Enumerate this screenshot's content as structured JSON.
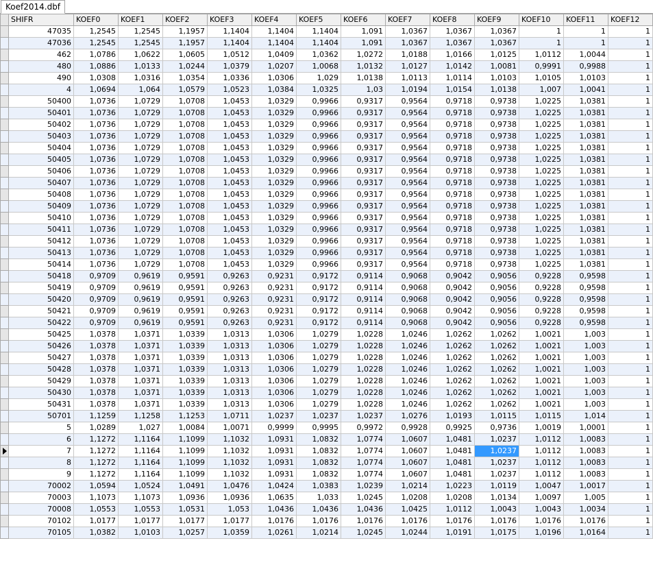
{
  "window": {
    "tab_label": "Koef2014.dbf"
  },
  "columns": [
    "SHIFR",
    "KOEF0",
    "KOEF1",
    "KOEF2",
    "KOEF3",
    "KOEF4",
    "KOEF5",
    "KOEF6",
    "KOEF7",
    "KOEF8",
    "KOEF9",
    "KOEF10",
    "KOEF11",
    "KOEF12"
  ],
  "rows": [
    [
      "47035",
      "1,2545",
      "1,2545",
      "1,1957",
      "1,1404",
      "1,1404",
      "1,1404",
      "1,091",
      "1,0367",
      "1,0367",
      "1,0367",
      "1",
      "1",
      "1"
    ],
    [
      "47036",
      "1,2545",
      "1,2545",
      "1,1957",
      "1,1404",
      "1,1404",
      "1,1404",
      "1,091",
      "1,0367",
      "1,0367",
      "1,0367",
      "1",
      "1",
      "1"
    ],
    [
      "462",
      "1,0786",
      "1,0622",
      "1,0605",
      "1,0512",
      "1,0409",
      "1,0362",
      "1,0272",
      "1,0188",
      "1,0166",
      "1,0125",
      "1,0112",
      "1,0044",
      "1"
    ],
    [
      "480",
      "1,0886",
      "1,0133",
      "1,0244",
      "1,0379",
      "1,0207",
      "1,0068",
      "1,0132",
      "1,0127",
      "1,0142",
      "1,0081",
      "0,9991",
      "0,9988",
      "1"
    ],
    [
      "490",
      "1,0308",
      "1,0316",
      "1,0354",
      "1,0336",
      "1,0306",
      "1,029",
      "1,0138",
      "1,0113",
      "1,0114",
      "1,0103",
      "1,0105",
      "1,0103",
      "1"
    ],
    [
      "4",
      "1,0694",
      "1,064",
      "1,0579",
      "1,0523",
      "1,0384",
      "1,0325",
      "1,03",
      "1,0194",
      "1,0154",
      "1,0138",
      "1,007",
      "1,0041",
      "1"
    ],
    [
      "50400",
      "1,0736",
      "1,0729",
      "1,0708",
      "1,0453",
      "1,0329",
      "0,9966",
      "0,9317",
      "0,9564",
      "0,9718",
      "0,9738",
      "1,0225",
      "1,0381",
      "1"
    ],
    [
      "50401",
      "1,0736",
      "1,0729",
      "1,0708",
      "1,0453",
      "1,0329",
      "0,9966",
      "0,9317",
      "0,9564",
      "0,9718",
      "0,9738",
      "1,0225",
      "1,0381",
      "1"
    ],
    [
      "50402",
      "1,0736",
      "1,0729",
      "1,0708",
      "1,0453",
      "1,0329",
      "0,9966",
      "0,9317",
      "0,9564",
      "0,9718",
      "0,9738",
      "1,0225",
      "1,0381",
      "1"
    ],
    [
      "50403",
      "1,0736",
      "1,0729",
      "1,0708",
      "1,0453",
      "1,0329",
      "0,9966",
      "0,9317",
      "0,9564",
      "0,9718",
      "0,9738",
      "1,0225",
      "1,0381",
      "1"
    ],
    [
      "50404",
      "1,0736",
      "1,0729",
      "1,0708",
      "1,0453",
      "1,0329",
      "0,9966",
      "0,9317",
      "0,9564",
      "0,9718",
      "0,9738",
      "1,0225",
      "1,0381",
      "1"
    ],
    [
      "50405",
      "1,0736",
      "1,0729",
      "1,0708",
      "1,0453",
      "1,0329",
      "0,9966",
      "0,9317",
      "0,9564",
      "0,9718",
      "0,9738",
      "1,0225",
      "1,0381",
      "1"
    ],
    [
      "50406",
      "1,0736",
      "1,0729",
      "1,0708",
      "1,0453",
      "1,0329",
      "0,9966",
      "0,9317",
      "0,9564",
      "0,9718",
      "0,9738",
      "1,0225",
      "1,0381",
      "1"
    ],
    [
      "50407",
      "1,0736",
      "1,0729",
      "1,0708",
      "1,0453",
      "1,0329",
      "0,9966",
      "0,9317",
      "0,9564",
      "0,9718",
      "0,9738",
      "1,0225",
      "1,0381",
      "1"
    ],
    [
      "50408",
      "1,0736",
      "1,0729",
      "1,0708",
      "1,0453",
      "1,0329",
      "0,9966",
      "0,9317",
      "0,9564",
      "0,9718",
      "0,9738",
      "1,0225",
      "1,0381",
      "1"
    ],
    [
      "50409",
      "1,0736",
      "1,0729",
      "1,0708",
      "1,0453",
      "1,0329",
      "0,9966",
      "0,9317",
      "0,9564",
      "0,9718",
      "0,9738",
      "1,0225",
      "1,0381",
      "1"
    ],
    [
      "50410",
      "1,0736",
      "1,0729",
      "1,0708",
      "1,0453",
      "1,0329",
      "0,9966",
      "0,9317",
      "0,9564",
      "0,9718",
      "0,9738",
      "1,0225",
      "1,0381",
      "1"
    ],
    [
      "50411",
      "1,0736",
      "1,0729",
      "1,0708",
      "1,0453",
      "1,0329",
      "0,9966",
      "0,9317",
      "0,9564",
      "0,9718",
      "0,9738",
      "1,0225",
      "1,0381",
      "1"
    ],
    [
      "50412",
      "1,0736",
      "1,0729",
      "1,0708",
      "1,0453",
      "1,0329",
      "0,9966",
      "0,9317",
      "0,9564",
      "0,9718",
      "0,9738",
      "1,0225",
      "1,0381",
      "1"
    ],
    [
      "50413",
      "1,0736",
      "1,0729",
      "1,0708",
      "1,0453",
      "1,0329",
      "0,9966",
      "0,9317",
      "0,9564",
      "0,9718",
      "0,9738",
      "1,0225",
      "1,0381",
      "1"
    ],
    [
      "50414",
      "1,0736",
      "1,0729",
      "1,0708",
      "1,0453",
      "1,0329",
      "0,9966",
      "0,9317",
      "0,9564",
      "0,9718",
      "0,9738",
      "1,0225",
      "1,0381",
      "1"
    ],
    [
      "50418",
      "0,9709",
      "0,9619",
      "0,9591",
      "0,9263",
      "0,9231",
      "0,9172",
      "0,9114",
      "0,9068",
      "0,9042",
      "0,9056",
      "0,9228",
      "0,9598",
      "1"
    ],
    [
      "50419",
      "0,9709",
      "0,9619",
      "0,9591",
      "0,9263",
      "0,9231",
      "0,9172",
      "0,9114",
      "0,9068",
      "0,9042",
      "0,9056",
      "0,9228",
      "0,9598",
      "1"
    ],
    [
      "50420",
      "0,9709",
      "0,9619",
      "0,9591",
      "0,9263",
      "0,9231",
      "0,9172",
      "0,9114",
      "0,9068",
      "0,9042",
      "0,9056",
      "0,9228",
      "0,9598",
      "1"
    ],
    [
      "50421",
      "0,9709",
      "0,9619",
      "0,9591",
      "0,9263",
      "0,9231",
      "0,9172",
      "0,9114",
      "0,9068",
      "0,9042",
      "0,9056",
      "0,9228",
      "0,9598",
      "1"
    ],
    [
      "50422",
      "0,9709",
      "0,9619",
      "0,9591",
      "0,9263",
      "0,9231",
      "0,9172",
      "0,9114",
      "0,9068",
      "0,9042",
      "0,9056",
      "0,9228",
      "0,9598",
      "1"
    ],
    [
      "50425",
      "1,0378",
      "1,0371",
      "1,0339",
      "1,0313",
      "1,0306",
      "1,0279",
      "1,0228",
      "1,0246",
      "1,0262",
      "1,0262",
      "1,0021",
      "1,003",
      "1"
    ],
    [
      "50426",
      "1,0378",
      "1,0371",
      "1,0339",
      "1,0313",
      "1,0306",
      "1,0279",
      "1,0228",
      "1,0246",
      "1,0262",
      "1,0262",
      "1,0021",
      "1,003",
      "1"
    ],
    [
      "50427",
      "1,0378",
      "1,0371",
      "1,0339",
      "1,0313",
      "1,0306",
      "1,0279",
      "1,0228",
      "1,0246",
      "1,0262",
      "1,0262",
      "1,0021",
      "1,003",
      "1"
    ],
    [
      "50428",
      "1,0378",
      "1,0371",
      "1,0339",
      "1,0313",
      "1,0306",
      "1,0279",
      "1,0228",
      "1,0246",
      "1,0262",
      "1,0262",
      "1,0021",
      "1,003",
      "1"
    ],
    [
      "50429",
      "1,0378",
      "1,0371",
      "1,0339",
      "1,0313",
      "1,0306",
      "1,0279",
      "1,0228",
      "1,0246",
      "1,0262",
      "1,0262",
      "1,0021",
      "1,003",
      "1"
    ],
    [
      "50430",
      "1,0378",
      "1,0371",
      "1,0339",
      "1,0313",
      "1,0306",
      "1,0279",
      "1,0228",
      "1,0246",
      "1,0262",
      "1,0262",
      "1,0021",
      "1,003",
      "1"
    ],
    [
      "50431",
      "1,0378",
      "1,0371",
      "1,0339",
      "1,0313",
      "1,0306",
      "1,0279",
      "1,0228",
      "1,0246",
      "1,0262",
      "1,0262",
      "1,0021",
      "1,003",
      "1"
    ],
    [
      "50701",
      "1,1259",
      "1,1258",
      "1,1253",
      "1,0711",
      "1,0237",
      "1,0237",
      "1,0237",
      "1,0276",
      "1,0193",
      "1,0115",
      "1,0115",
      "1,014",
      "1"
    ],
    [
      "5",
      "1,0289",
      "1,027",
      "1,0084",
      "1,0071",
      "0,9999",
      "0,9995",
      "0,9972",
      "0,9928",
      "0,9925",
      "0,9736",
      "1,0019",
      "1,0001",
      "1"
    ],
    [
      "6",
      "1,1272",
      "1,1164",
      "1,1099",
      "1,1032",
      "1,0931",
      "1,0832",
      "1,0774",
      "1,0607",
      "1,0481",
      "1,0237",
      "1,0112",
      "1,0083",
      "1"
    ],
    [
      "7",
      "1,1272",
      "1,1164",
      "1,1099",
      "1,1032",
      "1,0931",
      "1,0832",
      "1,0774",
      "1,0607",
      "1,0481",
      "1,0237",
      "1,0112",
      "1,0083",
      "1"
    ],
    [
      "8",
      "1,1272",
      "1,1164",
      "1,1099",
      "1,1032",
      "1,0931",
      "1,0832",
      "1,0774",
      "1,0607",
      "1,0481",
      "1,0237",
      "1,0112",
      "1,0083",
      "1"
    ],
    [
      "9",
      "1,1272",
      "1,1164",
      "1,1099",
      "1,1032",
      "1,0931",
      "1,0832",
      "1,0774",
      "1,0607",
      "1,0481",
      "1,0237",
      "1,0112",
      "1,0083",
      "1"
    ],
    [
      "70002",
      "1,0594",
      "1,0524",
      "1,0491",
      "1,0476",
      "1,0424",
      "1,0383",
      "1,0239",
      "1,0214",
      "1,0223",
      "1,0119",
      "1,0047",
      "1,0017",
      "1"
    ],
    [
      "70003",
      "1,1073",
      "1,1073",
      "1,0936",
      "1,0936",
      "1,0635",
      "1,033",
      "1,0245",
      "1,0208",
      "1,0208",
      "1,0134",
      "1,0097",
      "1,005",
      "1"
    ],
    [
      "70008",
      "1,0553",
      "1,0553",
      "1,0531",
      "1,053",
      "1,0436",
      "1,0436",
      "1,0436",
      "1,0425",
      "1,0112",
      "1,0043",
      "1,0043",
      "1,0034",
      "1"
    ],
    [
      "70102",
      "1,0177",
      "1,0177",
      "1,0177",
      "1,0177",
      "1,0176",
      "1,0176",
      "1,0176",
      "1,0176",
      "1,0176",
      "1,0176",
      "1,0176",
      "1,0176",
      "1"
    ],
    [
      "70105",
      "1,0382",
      "1,0103",
      "1,0257",
      "1,0359",
      "1,0261",
      "1,0214",
      "1,0245",
      "1,0244",
      "1,0191",
      "1,0175",
      "1,0196",
      "1,0164",
      "1"
    ]
  ],
  "current_row_index": 36,
  "selected_cell": {
    "row": 36,
    "column": 10
  }
}
